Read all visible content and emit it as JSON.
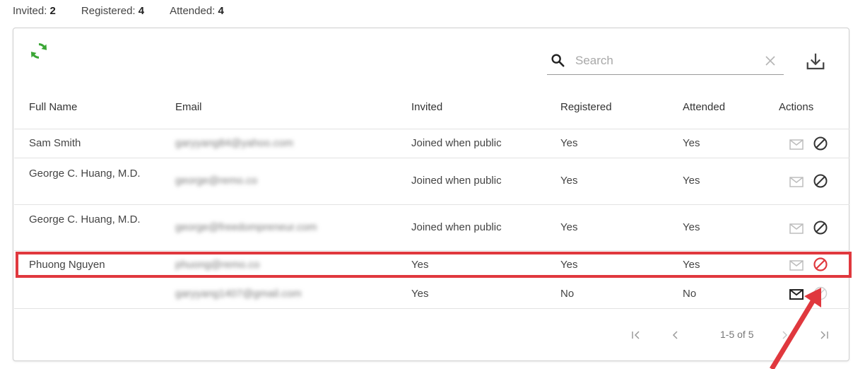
{
  "stats": {
    "invited_label": "Invited:",
    "invited_value": "2",
    "registered_label": "Registered:",
    "registered_value": "4",
    "attended_label": "Attended:",
    "attended_value": "4"
  },
  "toolbar": {
    "search_placeholder": "Search"
  },
  "table": {
    "headers": [
      "Full Name",
      "Email",
      "Invited",
      "Registered",
      "Attended",
      "Actions"
    ],
    "rows": [
      {
        "name": "Sam Smith",
        "email": "garyyang84@yahoo.com",
        "invited": "Joined when public",
        "registered": "Yes",
        "attended": "Yes"
      },
      {
        "name": "George C. Huang, M.D.",
        "email": "george@remo.co",
        "invited": "Joined when public",
        "registered": "Yes",
        "attended": "Yes"
      },
      {
        "name": "George C. Huang, M.D.",
        "email": "george@freedompreneur.com",
        "invited": "Joined when public",
        "registered": "Yes",
        "attended": "Yes"
      },
      {
        "name": "Phuong Nguyen",
        "email": "phuong@remo.co",
        "invited": "Yes",
        "registered": "Yes",
        "attended": "Yes"
      },
      {
        "name": "",
        "email": "garyyang1407@gmail.com",
        "invited": "Yes",
        "registered": "No",
        "attended": "No"
      }
    ]
  },
  "pagination": {
    "range": "1-5 of 5"
  },
  "colors": {
    "refresh": "#3aa635",
    "highlight": "#e0383e",
    "icon": "#333333",
    "icon_muted": "#bdbdbd"
  }
}
